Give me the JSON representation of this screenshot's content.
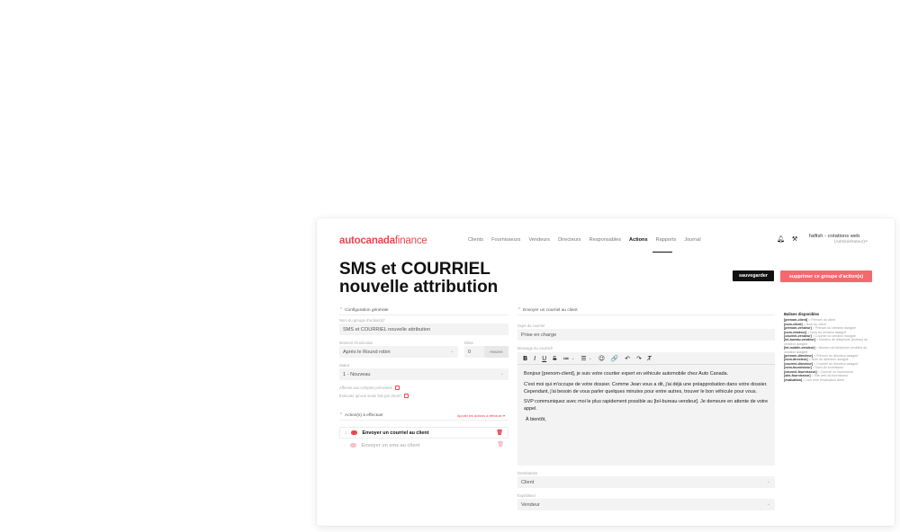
{
  "app": {
    "logo_bold": "autocanadafinance",
    "logo_brand": "autocanada",
    "logo_rest": "finance"
  },
  "nav": {
    "items": [
      "Clients",
      "Fournisseurs",
      "Vendeurs",
      "Directeurs",
      "Responsables",
      "Actions",
      "Rapports",
      "Journal"
    ],
    "active": "Actions"
  },
  "user": {
    "name": "fatfish - créations web",
    "role": "(Administrateur)"
  },
  "page": {
    "title": "SMS et COURRIEL nouvelle attribution",
    "save_label": "sauvegarder",
    "delete_label": "supprimer ce groupe d'action(s)"
  },
  "config": {
    "section_label": "Configuration générale",
    "group_name_label": "Nom du groupe d'action(s)*",
    "group_name_value": "SMS et COURRIEL nouvelle attribution",
    "moment_label": "Moment d'exécution",
    "moment_value": "Après le Round robin",
    "delay_label": "Délai",
    "delay_value": "0",
    "delay_unit": "Heures",
    "status_label": "Statut",
    "status_value": "1 - Nouveau",
    "check1_label": "Affecter aux comptes préventés",
    "check2_label": "Exécuter qu'une seule fois par client?"
  },
  "actions": {
    "section_label": "Action(s) à effectuer",
    "order_link": "Ajouter les actions à effectuer",
    "items": [
      {
        "label": "Envoyer un courriel au client",
        "enabled": true
      },
      {
        "label": "Envoyer un sms au client",
        "enabled": false
      }
    ]
  },
  "email": {
    "section_label": "Envoyer un courriel au client",
    "subject_label": "Sujet du courriel",
    "subject_value": "Prise en charge",
    "message_label": "Message du courriel*",
    "toolbar": [
      "B",
      "I",
      "U",
      "S",
      "≔",
      "⌄",
      "☰",
      "⌄",
      "☺",
      "🔗",
      "↶",
      "↷",
      "T̸"
    ],
    "body": [
      "Bonjour [prenom-client], je suis votre courtier expert en véhicule automobile chez Auto Canada.",
      "C'est moi qui m'occupe de votre dossier. Comme Jean vous a dit, j'ai déjà une préapprobation dans votre dossier. Cependant, j'ai besoin de vous parler quelques minutes pour entre autres, trouver le bon véhicule pour vous.",
      "SVP communiquez avec moi le plus rapidement possible au [tel-bureau-vendeur]. Je demeure en attente de votre appel.",
      "À bientôt,"
    ],
    "recipient_label": "Destinataire",
    "recipient_value": "Client",
    "sender_label": "Expéditeur",
    "sender_value": "Vendeur"
  },
  "tags": {
    "title": "Balises disponibles",
    "items": [
      {
        "tag": "[prenom-client]",
        "desc": "= Prénom du client"
      },
      {
        "tag": "[nom-client]",
        "desc": "= Nom du client"
      },
      {
        "tag": "[prenom-vendeur]",
        "desc": "= Prénom du vendeur assigné"
      },
      {
        "tag": "[nom-vendeur]",
        "desc": "= Nom du vendeur assigné"
      },
      {
        "tag": "[courriel-vendeur]",
        "desc": "= Courriel du vendeur assigné"
      },
      {
        "tag": "[tel-bureau-vendeur]",
        "desc": "= Numéro de téléphone (bureau) du vendeur assigné"
      },
      {
        "tag": "[tel-mobile-vendeur]",
        "desc": "= Numéro de téléphone (mobile) du vendeur assigné"
      },
      {
        "tag": "[prenom-directeur]",
        "desc": "= Prénom du directeur assigné"
      },
      {
        "tag": "[nom-directeur]",
        "desc": "= Nom du directeur assigné"
      },
      {
        "tag": "[courriel-directeur]",
        "desc": "= Courriel du directeur assigné"
      },
      {
        "tag": "[nom-fournisseur]",
        "desc": "= Nom du fournisseur"
      },
      {
        "tag": "[courriel-fournisseur]",
        "desc": "= Courriel du fournisseur"
      },
      {
        "tag": "[site-fournisseur]",
        "desc": "= Site web du fournisseur"
      },
      {
        "tag": "[evaluation]",
        "desc": "= Lien vers l'évaluation client"
      }
    ]
  },
  "icons": {
    "bell": "bell-icon",
    "tools": "tools-icon",
    "chevron": "chevron-down-icon",
    "trash": "trash-icon",
    "drag": "drag-handle-icon"
  },
  "colors": {
    "brand_red": "#e8474e",
    "delete_button": "#f26a6f",
    "save_button": "#111111"
  }
}
